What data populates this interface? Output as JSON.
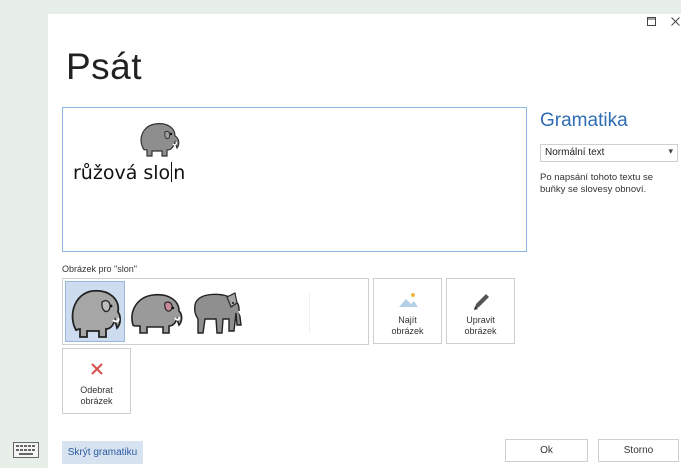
{
  "window": {
    "maximize_icon": "maximize-icon",
    "close_icon": "close-icon"
  },
  "page": {
    "title": "Psát"
  },
  "editor": {
    "text_before_caret": "růžová slo",
    "text_after_caret": "n",
    "symbol_icon": "elephant-symbol"
  },
  "grammar": {
    "title": "Gramatika",
    "mode": "Normální text",
    "note": "Po napsání tohoto textu se buňky se slovesy obnoví."
  },
  "picture": {
    "label": "Obrázek pro \"slon\"",
    "options": [
      "elephant-1",
      "elephant-2",
      "elephant-3"
    ],
    "selected_index": 0
  },
  "actions": {
    "find": "Najít\nobrázek",
    "edit": "Upravit\nobrázek",
    "remove": "Odebrat\nobrázek"
  },
  "footer": {
    "hide_grammar": "Skrýt gramatiku",
    "ok": "Ok",
    "cancel": "Storno"
  },
  "colors": {
    "accent": "#2f6db3",
    "remove": "#d9534f"
  }
}
